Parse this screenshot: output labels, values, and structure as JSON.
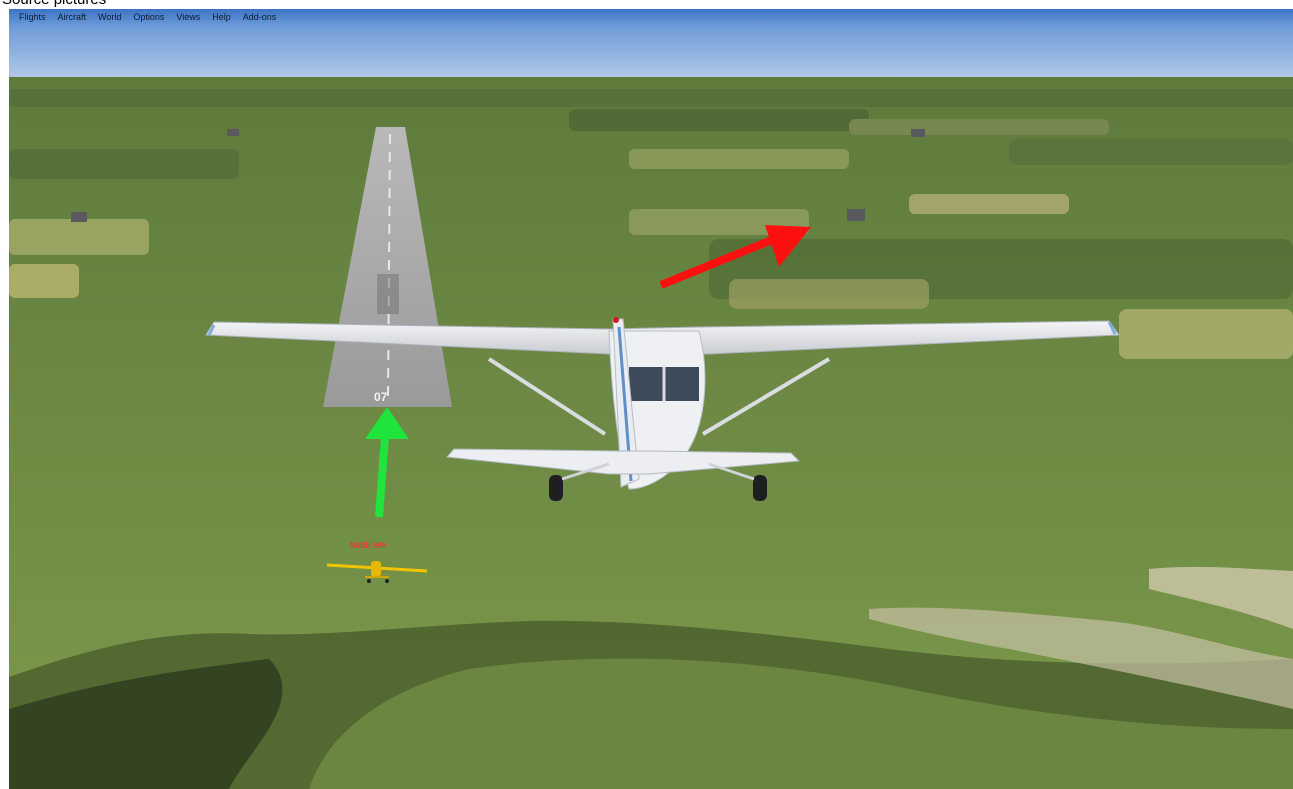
{
  "caption": "Source pictures",
  "menu": [
    "Flights",
    "Aircraft",
    "World",
    "Options",
    "Views",
    "Help",
    "Add-ons"
  ],
  "runway_number": "07",
  "traffic_callsign": "N4BE-WA",
  "colors": {
    "sky_top": "#3c78c8",
    "sky_bottom": "#a9c3e6",
    "grass": "#6f8a44",
    "arrow_green": "#1fe43b",
    "arrow_red": "#ff1010",
    "traffic_aircraft": "#f2c400",
    "callsign_text": "#ff2a2a"
  },
  "icons": [
    "green-arrow-icon",
    "red-arrow-icon"
  ]
}
